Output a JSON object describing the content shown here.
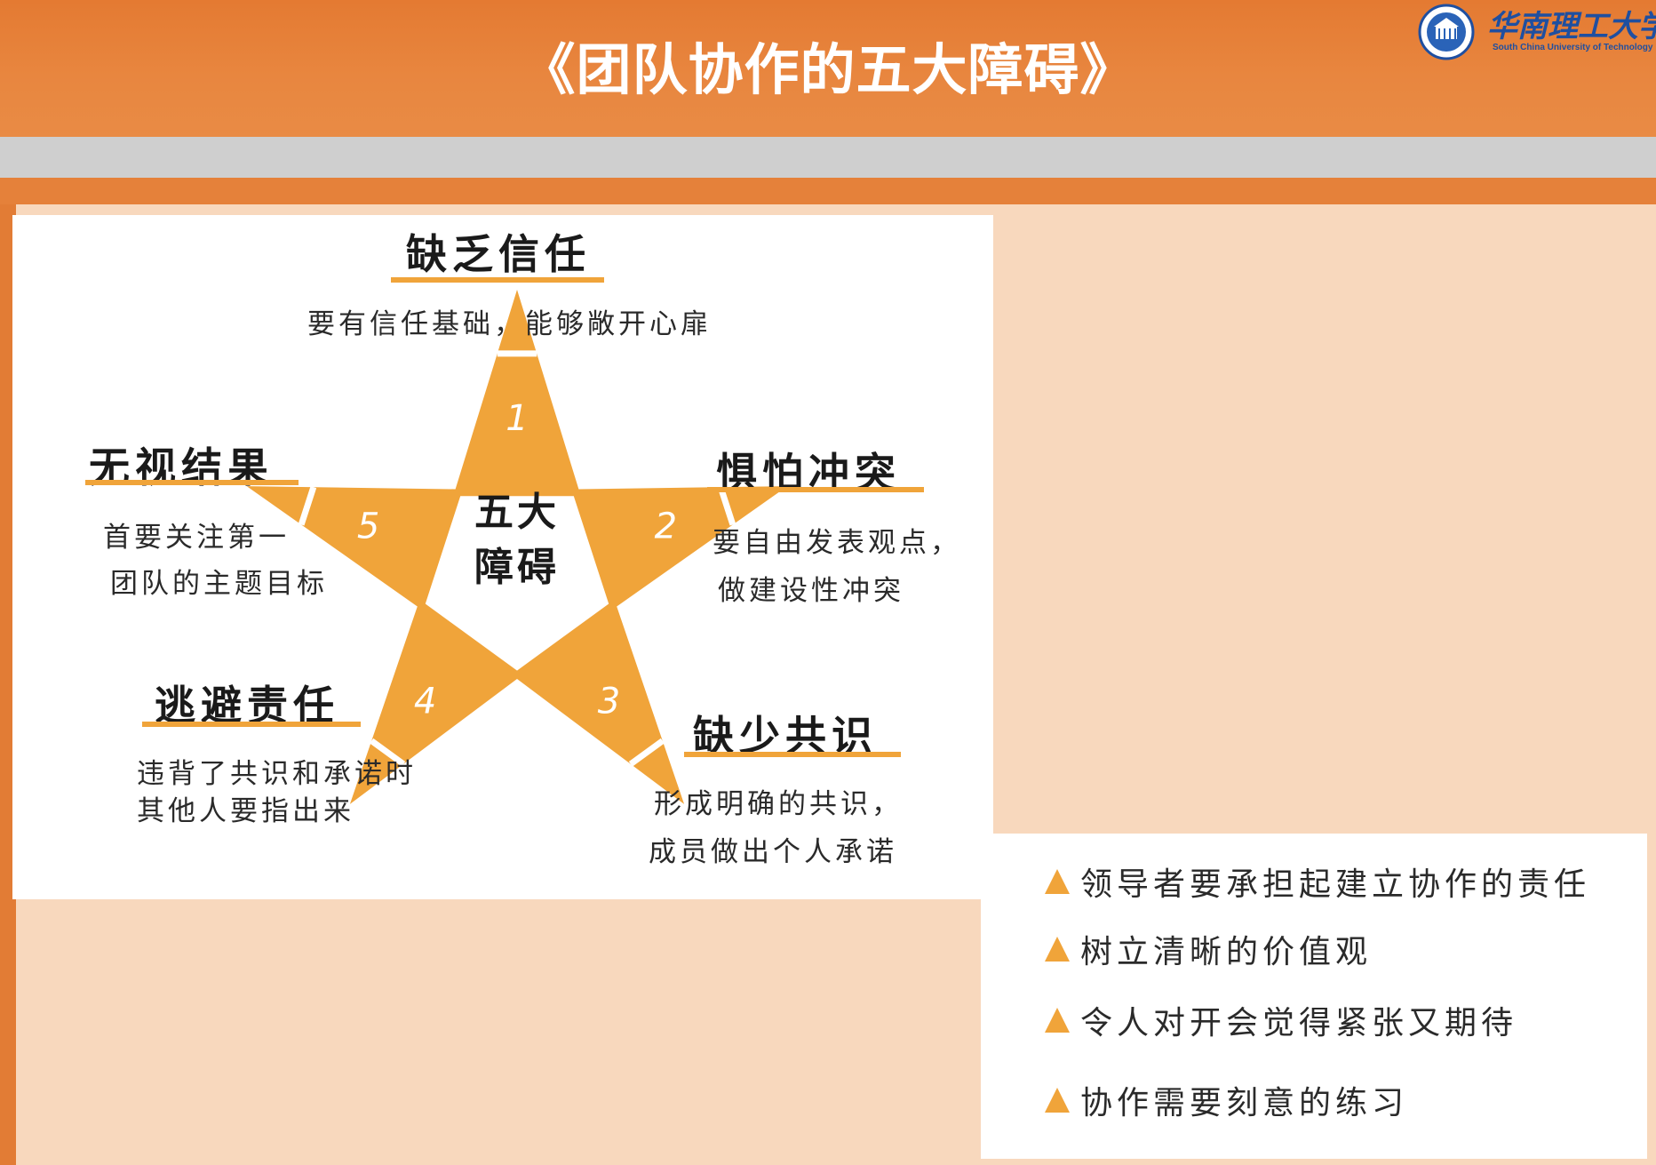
{
  "header": {
    "title": "《团队协作的五大障碍》",
    "logo_cn": "华南理工大学",
    "logo_en": "South China University of Technology"
  },
  "diagram": {
    "center_line1": "五大",
    "center_line2": "障碍",
    "points": [
      {
        "number": "1",
        "heading": "缺乏信任",
        "desc_lines": [
          "要有信任基础，能够敞开心扉"
        ]
      },
      {
        "number": "2",
        "heading": "惧怕冲突",
        "desc_lines": [
          "要自由发表观点，",
          "做建设性冲突"
        ]
      },
      {
        "number": "3",
        "heading": "缺少共识",
        "desc_lines": [
          "形成明确的共识，",
          "成员做出个人承诺"
        ]
      },
      {
        "number": "4",
        "heading": "逃避责任",
        "desc_lines": [
          "违背了共识和承诺时",
          "其他人要指出来"
        ]
      },
      {
        "number": "5",
        "heading": "无视结果",
        "desc_lines": [
          "首要关注第一",
          "团队的主题目标"
        ]
      }
    ],
    "star_color": "#f0a43a"
  },
  "bullets": [
    "领导者要承担起建立协作的责任",
    "树立清晰的价值观",
    "令人对开会觉得紧张又期待",
    "协作需要刻意的练习"
  ],
  "colors": {
    "header_orange": "#e47a32",
    "peach": "#f8d8bd",
    "accent": "#f0a43a",
    "logo_blue": "#1f4fa0"
  }
}
